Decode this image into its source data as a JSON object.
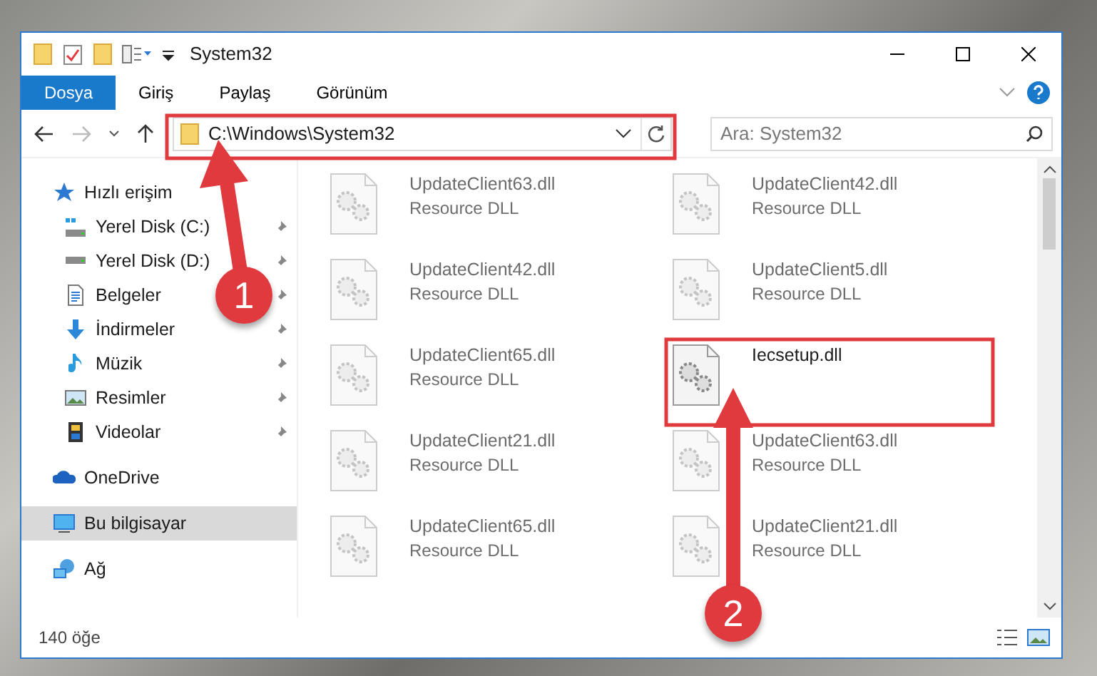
{
  "window": {
    "title": "System32"
  },
  "ribbon_tabs": [
    {
      "label": "Dosya",
      "kind": "file"
    },
    {
      "label": "Giriş",
      "kind": "tab"
    },
    {
      "label": "Paylaş",
      "kind": "tab"
    },
    {
      "label": "Görünüm",
      "kind": "tab"
    }
  ],
  "address_bar": {
    "path": "C:\\Windows\\System32"
  },
  "search": {
    "placeholder": "Ara: System32"
  },
  "sidebar": {
    "items": [
      {
        "label": "Hızlı erişim",
        "selected": false,
        "children": [
          {
            "label": "Yerel Disk (C:)",
            "selected": false,
            "pinned": true
          },
          {
            "label": "Yerel Disk (D:)",
            "selected": false,
            "pinned": true
          },
          {
            "label": "Belgeler",
            "selected": false,
            "pinned": true
          },
          {
            "label": "İndirmeler",
            "selected": false,
            "pinned": true
          },
          {
            "label": "Müzik",
            "selected": false,
            "pinned": true
          },
          {
            "label": "Resimler",
            "selected": false,
            "pinned": true
          },
          {
            "label": "Videolar",
            "selected": false,
            "pinned": true
          }
        ]
      },
      {
        "label": "OneDrive",
        "selected": false
      },
      {
        "label": "Bu bilgisayar",
        "selected": true
      },
      {
        "label": "Ağ",
        "selected": false
      }
    ]
  },
  "files": [
    {
      "name": "UpdateClient63.dll",
      "type": "Resource DLL",
      "blurred": true
    },
    {
      "name": "UpdateClient42.dll",
      "type": "Resource DLL",
      "blurred": true
    },
    {
      "name": "UpdateClient42.dll",
      "type": "Resource DLL",
      "blurred": true
    },
    {
      "name": "UpdateClient5.dll",
      "type": "Resource DLL",
      "blurred": true
    },
    {
      "name": "UpdateClient65.dll",
      "type": "Resource DLL",
      "blurred": true
    },
    {
      "name": "Iecsetup.dll",
      "blurred": false
    },
    {
      "name": "UpdateClient21.dll",
      "type": "Resource DLL",
      "blurred": true
    },
    {
      "name": "UpdateClient63.dll",
      "type": "Resource DLL",
      "blurred": true
    },
    {
      "name": "UpdateClient65.dll",
      "type": "Resource DLL",
      "blurred": true
    },
    {
      "name": "UpdateClient21.dll",
      "type": "Resource DLL",
      "blurred": true
    }
  ],
  "status_bar": {
    "item_count": "140 öğe"
  },
  "annotations": [
    {
      "number": "1"
    },
    {
      "number": "2"
    }
  ]
}
